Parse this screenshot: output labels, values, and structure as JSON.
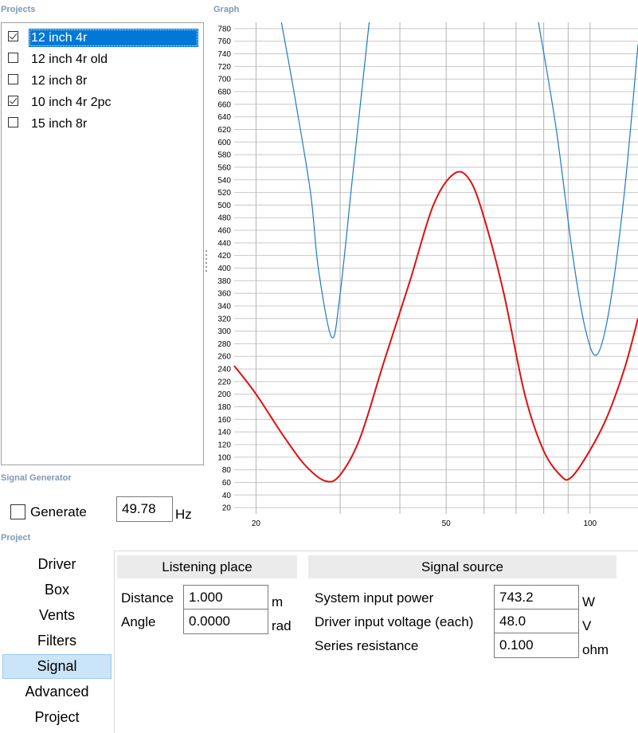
{
  "sections": {
    "projects": "Projects",
    "graph": "Graph",
    "signal_generator": "Signal Generator",
    "project": "Project"
  },
  "projects": [
    {
      "label": "12 inch 4r",
      "checked": true,
      "selected": true
    },
    {
      "label": "12 inch 4r old",
      "checked": false,
      "selected": false
    },
    {
      "label": "12 inch 8r",
      "checked": false,
      "selected": false
    },
    {
      "label": "10 inch 4r 2pc",
      "checked": true,
      "selected": false
    },
    {
      "label": "15 inch 8r",
      "checked": false,
      "selected": false
    }
  ],
  "signal_generator": {
    "generate_label": "Generate",
    "generate_checked": false,
    "frequency": "49.78",
    "unit": "Hz"
  },
  "nav": {
    "items": [
      "Driver",
      "Box",
      "Vents",
      "Filters",
      "Signal",
      "Advanced",
      "Project"
    ],
    "selected": "Signal"
  },
  "listening_place": {
    "title": "Listening place",
    "distance_label": "Distance",
    "distance_value": "1.000",
    "distance_unit": "m",
    "angle_label": "Angle",
    "angle_value": "0.0000",
    "angle_unit": "rad"
  },
  "signal_source": {
    "title": "Signal source",
    "power_label": "System input power",
    "power_value": "743.2",
    "power_unit": "W",
    "voltage_label": "Driver input voltage (each)",
    "voltage_value": "48.0",
    "voltage_unit": "V",
    "resistance_label": "Series resistance",
    "resistance_value": "0.100",
    "resistance_unit": "ohm"
  },
  "colors": {
    "accent": "#0078d7",
    "section_title": "#7f97b8",
    "series_blue": "#1f78c8",
    "series_red": "#e01010"
  },
  "chart_data": {
    "type": "line",
    "x_scale": "log",
    "xlim": [
      18,
      126
    ],
    "ylim": [
      10,
      790
    ],
    "y_ticks": [
      20,
      40,
      60,
      80,
      100,
      120,
      140,
      160,
      180,
      200,
      220,
      240,
      260,
      280,
      300,
      320,
      340,
      360,
      380,
      400,
      420,
      440,
      460,
      480,
      500,
      520,
      540,
      560,
      580,
      600,
      620,
      640,
      660,
      680,
      700,
      720,
      740,
      760,
      780
    ],
    "x_tick_labels": [
      20,
      50,
      100
    ],
    "x_grid": [
      20,
      30,
      40,
      50,
      60,
      70,
      80,
      90,
      100
    ],
    "grid": true,
    "series": [
      {
        "color": "#1f78c8",
        "points": [
          [
            22.6,
            790
          ],
          [
            24,
            680
          ],
          [
            26,
            520
          ],
          [
            27,
            400
          ],
          [
            28.8,
            290
          ],
          [
            30,
            360
          ],
          [
            32,
            560
          ],
          [
            34.5,
            790
          ]
        ]
      },
      {
        "color": "#1f78c8",
        "points": [
          [
            78,
            790
          ],
          [
            85,
            620
          ],
          [
            92,
            420
          ],
          [
            98,
            300
          ],
          [
            103.5,
            263
          ],
          [
            110,
            340
          ],
          [
            118,
            520
          ],
          [
            126,
            755
          ]
        ]
      },
      {
        "color": "#e01010",
        "points": [
          [
            18,
            245
          ],
          [
            20,
            200
          ],
          [
            23,
            130
          ],
          [
            25.5,
            85
          ],
          [
            28,
            62
          ],
          [
            30,
            72
          ],
          [
            33,
            130
          ],
          [
            37,
            250
          ],
          [
            42,
            380
          ],
          [
            47,
            500
          ],
          [
            52,
            550
          ],
          [
            56,
            540
          ],
          [
            60,
            480
          ],
          [
            66,
            360
          ],
          [
            73,
            200
          ],
          [
            80,
            110
          ],
          [
            87,
            70
          ],
          [
            91,
            67
          ],
          [
            98,
            100
          ],
          [
            108,
            160
          ],
          [
            118,
            240
          ],
          [
            126,
            320
          ]
        ]
      }
    ]
  }
}
